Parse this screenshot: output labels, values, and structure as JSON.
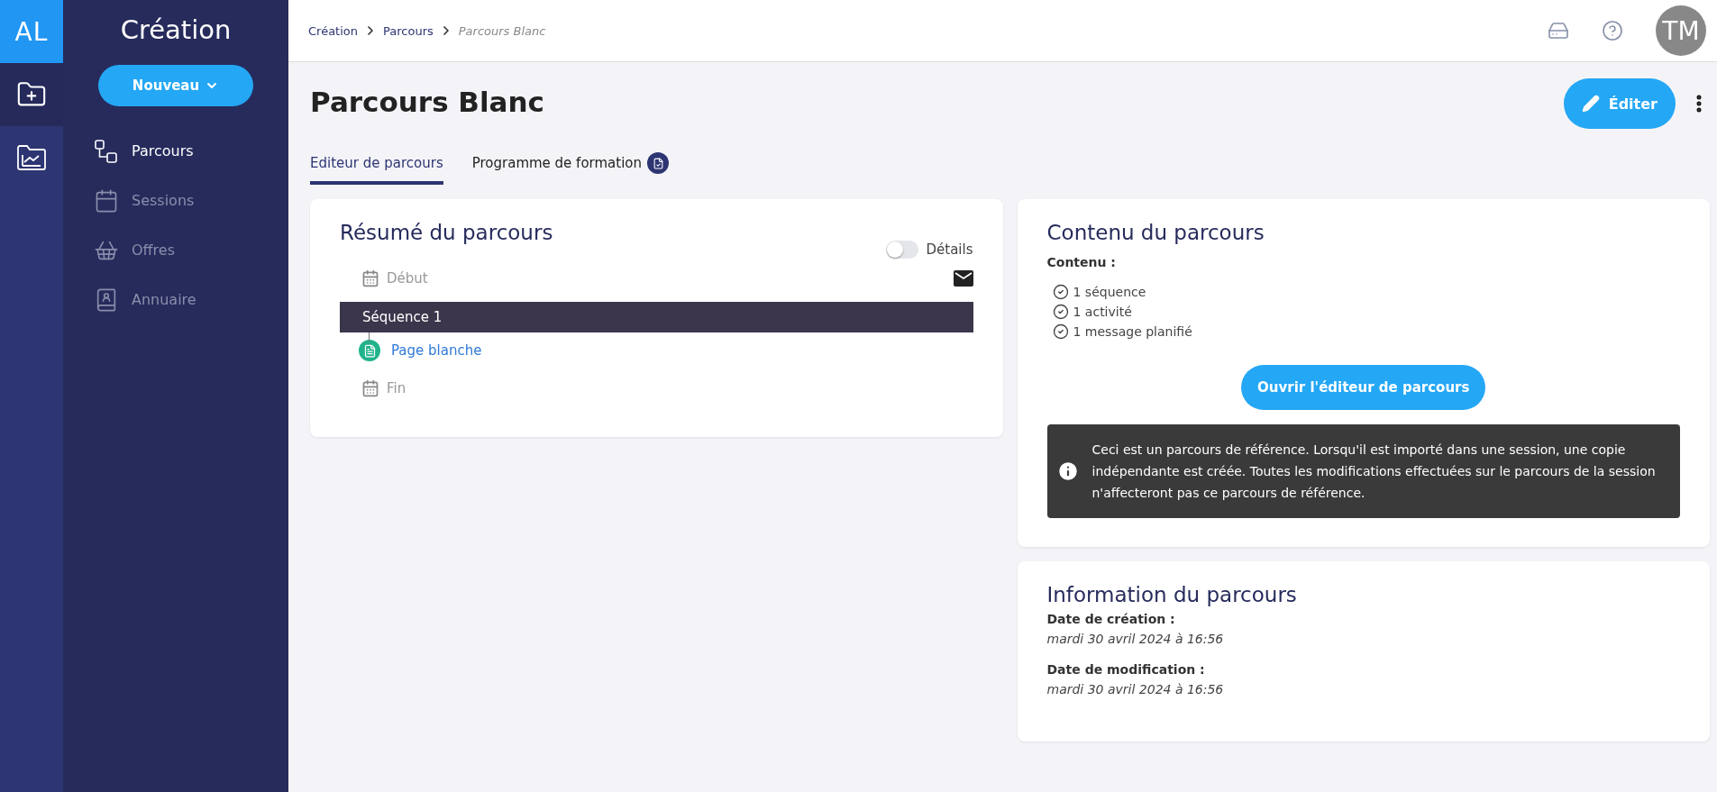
{
  "rail": {
    "logo": "AL",
    "items": [
      {
        "kind": "create",
        "selected": true
      },
      {
        "kind": "stats",
        "selected": false
      }
    ]
  },
  "sidebar": {
    "title": "Création",
    "new_button": "Nouveau",
    "items": [
      {
        "kind": "path",
        "label": "Parcours",
        "selected": true
      },
      {
        "kind": "calendar",
        "label": "Sessions",
        "selected": false
      },
      {
        "kind": "basket",
        "label": "Offres",
        "selected": false
      },
      {
        "kind": "contacts",
        "label": "Annuaire",
        "selected": false
      }
    ]
  },
  "breadcrumb": [
    {
      "label": "Création",
      "current": false
    },
    {
      "label": "Parcours",
      "current": false
    },
    {
      "label": "Parcours Blanc",
      "current": true
    }
  ],
  "avatar": "TM",
  "page_title": "Parcours Blanc",
  "edit_button": "Éditer",
  "tabs": [
    {
      "label": "Editeur de parcours",
      "selected": true,
      "badge": false
    },
    {
      "label": "Programme de formation",
      "selected": false,
      "badge": true
    }
  ],
  "summary": {
    "title": "Résumé du parcours",
    "toggle": {
      "label": "Détails",
      "on": false
    },
    "steps": [
      {
        "kind": "start",
        "label": "Début"
      },
      {
        "kind": "sequence",
        "label": "Séquence 1"
      },
      {
        "kind": "activity",
        "label": "Page blanche"
      },
      {
        "kind": "end",
        "label": "Fin"
      }
    ]
  },
  "content": {
    "title": "Contenu du parcours",
    "label": "Contenu :",
    "items": [
      "1 séquence",
      "1 activité",
      "1 message planifié"
    ],
    "button": "Ouvrir l'éditeur de parcours",
    "notice": "Ceci est un parcours de référence. Lorsqu'il est importé dans une session, une copie indépendante est créée. Toutes les modifications effectuées sur le parcours de la session n'affecteront pas ce parcours de référence."
  },
  "info": {
    "title": "Information du parcours",
    "fields": [
      {
        "label": "Date de création :",
        "value": "mardi 30 avril 2024 à 16:56"
      },
      {
        "label": "Date de modification :",
        "value": "mardi 30 avril 2024 à 16:56"
      }
    ]
  }
}
